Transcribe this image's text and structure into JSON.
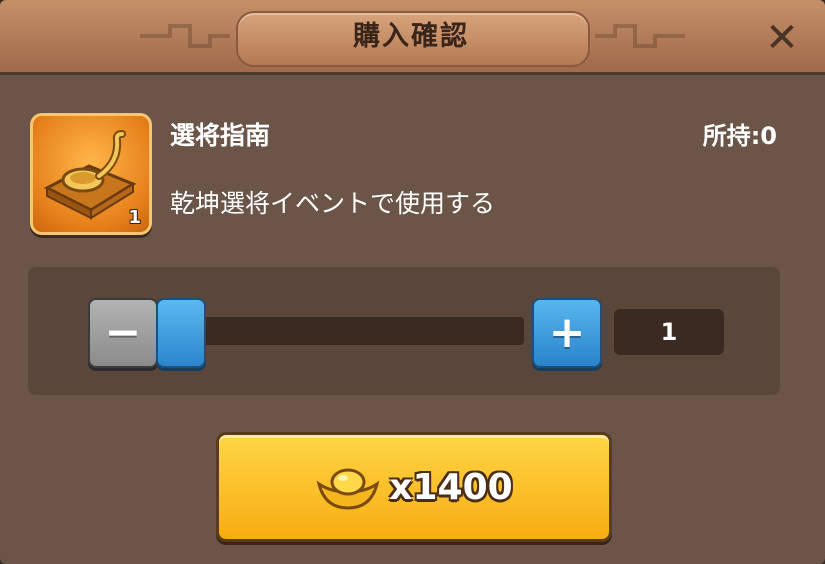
{
  "dialog": {
    "title": "購入確認",
    "close_icon": "close-icon"
  },
  "item": {
    "name": "選将指南",
    "owned_label": "所持:0",
    "description": "乾坤選将イベントで使用する",
    "icon_badge": "1",
    "icon": "golden-spoon-icon"
  },
  "quantity": {
    "minus_label": "−",
    "plus_label": "+",
    "value": "1",
    "slider_fraction": 0
  },
  "purchase": {
    "price_label": "x1400",
    "currency_icon": "gold-ingot-icon"
  },
  "colors": {
    "header": "#b07a56",
    "body": "#6b5548",
    "buy_button": "#f9be26",
    "plus_button": "#2f8ccf",
    "minus_button": "#9a9a9a"
  }
}
